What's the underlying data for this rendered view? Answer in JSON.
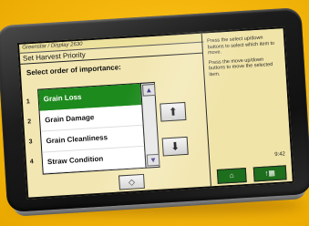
{
  "brand_text": "Greenstar / Display 2630",
  "title": "Set Harvest Priority",
  "instruction": "Select order of importance:",
  "numbers": [
    "1",
    "2",
    "3",
    "4"
  ],
  "list_items": [
    "Grain Loss",
    "Grain Damage",
    "Grain Cleanliness",
    "Straw Condition"
  ],
  "selected_index": 0,
  "scroll": {
    "up": "▲",
    "down": "▼"
  },
  "move_buttons": {
    "up": "⬆",
    "down": "⬇"
  },
  "ok_button": "◇",
  "help_text": [
    "Press the select up/down buttons to select which item to move.",
    "Press the move up/down buttons to move the selected item."
  ],
  "time": "9:42",
  "softkeys": {
    "home": "⌂",
    "grid": "↑▦"
  },
  "colors": {
    "background": "#f2b50a",
    "screen": "#f2e7b2",
    "selected": "#1d8a1d",
    "bezel": "#1c1c1c"
  }
}
